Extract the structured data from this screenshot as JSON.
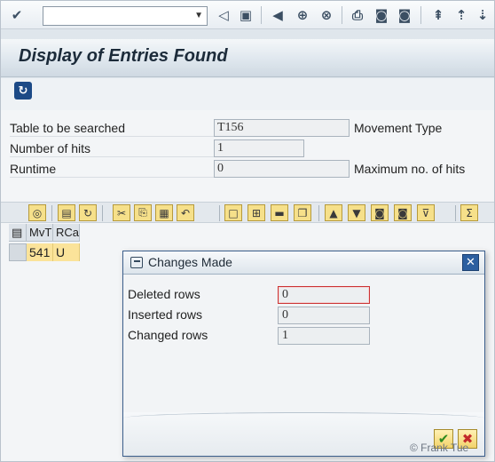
{
  "command_field": {
    "value": ""
  },
  "title": "Display of Entries Found",
  "form": {
    "table_label": "Table to be searched",
    "table_value": "T156",
    "table_desc": "Movement Type",
    "hits_label": "Number of hits",
    "hits_value": "1",
    "runtime_label": "Runtime",
    "runtime_value": "0",
    "runtime_desc": "Maximum no. of hits"
  },
  "grid": {
    "columns": [
      "MvT",
      "RCa"
    ],
    "rows": [
      {
        "mvt": "541",
        "rca": "U"
      }
    ]
  },
  "dialog": {
    "title": "Changes Made",
    "close_label": "✕",
    "fields": [
      {
        "label": "Deleted rows",
        "value": "0"
      },
      {
        "label": "Inserted rows",
        "value": "0"
      },
      {
        "label": "Changed rows",
        "value": "1"
      }
    ]
  },
  "icons": {
    "enter": "check-circle-icon",
    "save": "floppy-icon",
    "back": "back-icon",
    "exit": "exit-icon",
    "cancel": "cancel-icon",
    "print": "print-icon",
    "find": "binoculars-icon",
    "refresh": "refresh-icon"
  },
  "watermark": "© Frank Tue"
}
